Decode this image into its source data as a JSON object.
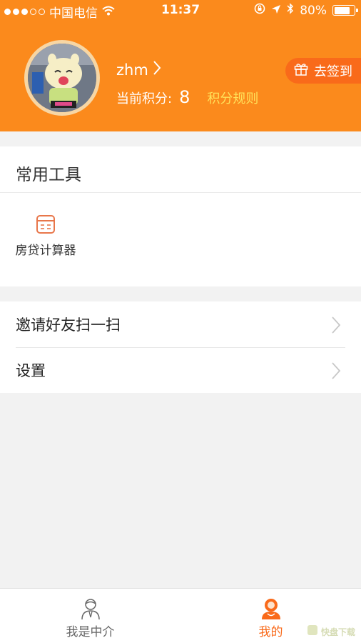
{
  "status_bar": {
    "carrier": "中国电信",
    "time": "11:37",
    "battery": "80%",
    "battery_level": 0.8
  },
  "profile": {
    "username": "zhm",
    "points_label": "当前积分:",
    "points_value": "8",
    "rules_link": "积分规则",
    "checkin_label": "去签到"
  },
  "tools": {
    "title": "常用工具",
    "items": [
      {
        "label": "房贷计算器",
        "icon": "calculator-icon"
      }
    ]
  },
  "menu": {
    "items": [
      {
        "label": "邀请好友扫一扫"
      },
      {
        "label": "设置"
      }
    ]
  },
  "tab_bar": {
    "tabs": [
      {
        "label": "我是中介",
        "icon": "agent-icon",
        "active": false
      },
      {
        "label": "我的",
        "icon": "me-icon",
        "active": true
      }
    ]
  },
  "watermark": {
    "text": "快盘下载"
  },
  "colors": {
    "header": "#fb8a1c",
    "accent": "#f96a1a",
    "rules_link": "#ffe25a",
    "background": "#f2f2f2"
  }
}
